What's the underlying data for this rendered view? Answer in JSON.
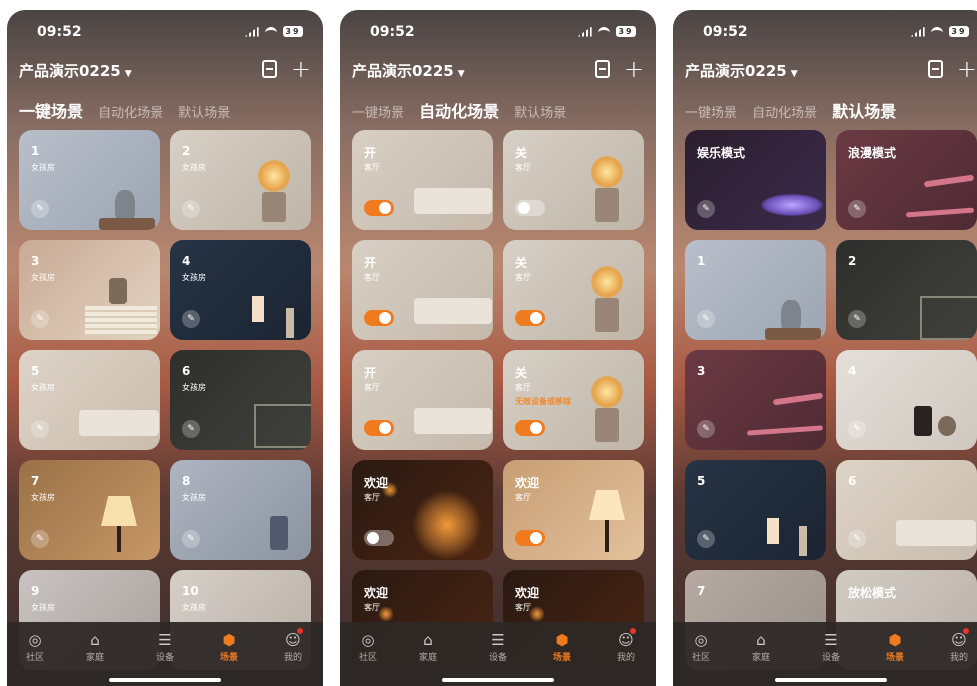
{
  "status": {
    "time": "09:52",
    "battery": "39"
  },
  "home_name": "产品演示0225",
  "tabs": [
    "一键场景",
    "自动化场景",
    "默认场景"
  ],
  "tabbar": [
    "社区",
    "家庭",
    "设备",
    "场景",
    "我的"
  ],
  "tabbar_icons": [
    "community-icon",
    "home-icon",
    "device-icon",
    "scene-icon",
    "profile-icon"
  ],
  "accent": "#f07a1e",
  "phone1": {
    "active_tab": 0,
    "cards": [
      {
        "name": "1",
        "room": "女孩房"
      },
      {
        "name": "2",
        "room": "女孩房"
      },
      {
        "name": "3",
        "room": "女孩房"
      },
      {
        "name": "4",
        "room": "女孩房"
      },
      {
        "name": "5",
        "room": "女孩房"
      },
      {
        "name": "6",
        "room": "女孩房"
      },
      {
        "name": "7",
        "room": "女孩房"
      },
      {
        "name": "8",
        "room": "女孩房"
      },
      {
        "name": "9",
        "room": "女孩房"
      },
      {
        "name": "10",
        "room": "女孩房"
      }
    ]
  },
  "phone2": {
    "active_tab": 1,
    "cards": [
      {
        "name": "开",
        "room": "客厅",
        "enabled": true
      },
      {
        "name": "关",
        "room": "客厅",
        "enabled": false
      },
      {
        "name": "开",
        "room": "客厅",
        "enabled": true
      },
      {
        "name": "关",
        "room": "客厅",
        "enabled": true
      },
      {
        "name": "开",
        "room": "客厅",
        "enabled": true
      },
      {
        "name": "关",
        "room": "客厅",
        "enabled": true,
        "warning": "无效设备或移除"
      },
      {
        "name": "欢迎",
        "room": "客厅",
        "enabled": false
      },
      {
        "name": "欢迎",
        "room": "客厅",
        "enabled": true
      },
      {
        "name": "欢迎",
        "room": "客厅"
      },
      {
        "name": "欢迎",
        "room": "客厅"
      }
    ]
  },
  "phone3": {
    "active_tab": 2,
    "cards": [
      {
        "name": "娱乐模式"
      },
      {
        "name": "浪漫模式"
      },
      {
        "name": "1"
      },
      {
        "name": "2"
      },
      {
        "name": "3"
      },
      {
        "name": "4"
      },
      {
        "name": "5"
      },
      {
        "name": "6"
      },
      {
        "name": "7"
      },
      {
        "name": "放松模式"
      }
    ]
  }
}
